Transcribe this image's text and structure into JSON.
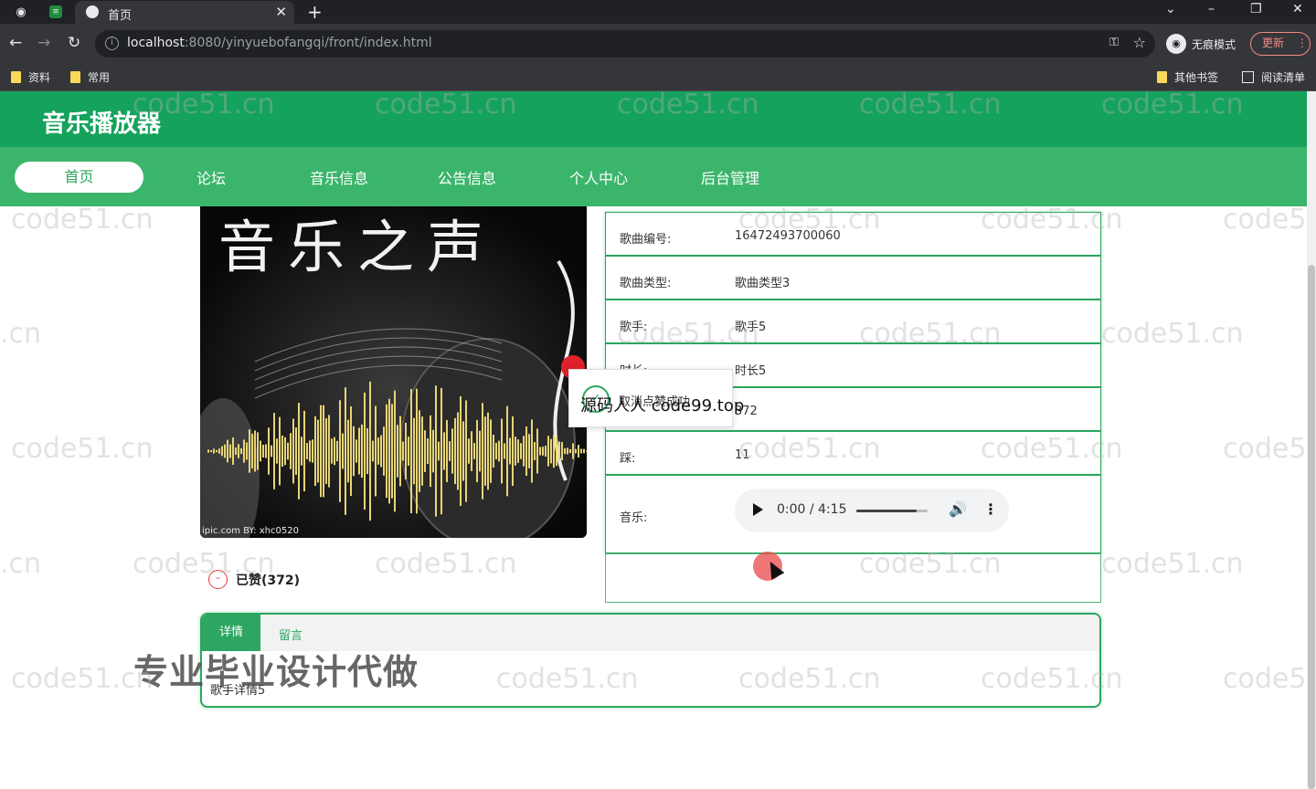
{
  "browser": {
    "tab_title": "首页",
    "url_host": "localhost",
    "url_rest": ":8080/yinyuebofangqi/front/index.html",
    "incognito_label": "无痕模式",
    "update_label": "更新",
    "bookmarks": [
      "资料",
      "常用"
    ],
    "other_bookmarks": "其他书签",
    "reading_list": "阅读清单"
  },
  "site": {
    "title": "音乐播放器",
    "nav": [
      "首页",
      "论坛",
      "音乐信息",
      "公告信息",
      "个人中心",
      "后台管理"
    ]
  },
  "cover": {
    "title": "音乐之声",
    "credit": "ipic.com   BY: xhc0520"
  },
  "song": {
    "rows": [
      {
        "label": "歌曲编号:",
        "value": "16472493700060"
      },
      {
        "label": "歌曲类型:",
        "value": "歌曲类型3"
      },
      {
        "label": "歌手:",
        "value": "歌手5"
      },
      {
        "label": "时长:",
        "value": "时长5"
      },
      {
        "label": "",
        "value": "372"
      },
      {
        "label": "踩:",
        "value": "11"
      }
    ],
    "music_label": "音乐:",
    "audio_time": "0:00 / 4:15",
    "audio_volume_level": 0.85
  },
  "toast": {
    "message": "取消点赞成功",
    "overlay": "源码人人 code99.top"
  },
  "like_text": "已赞(372)",
  "detail_tabs": {
    "detail": "详情",
    "message": "留言",
    "content": "歌手详情5"
  },
  "promo": "专业毕业设计代做",
  "watermark": "code51.cn",
  "watermark_partial": ".cn",
  "watermark_prefix": "code5"
}
